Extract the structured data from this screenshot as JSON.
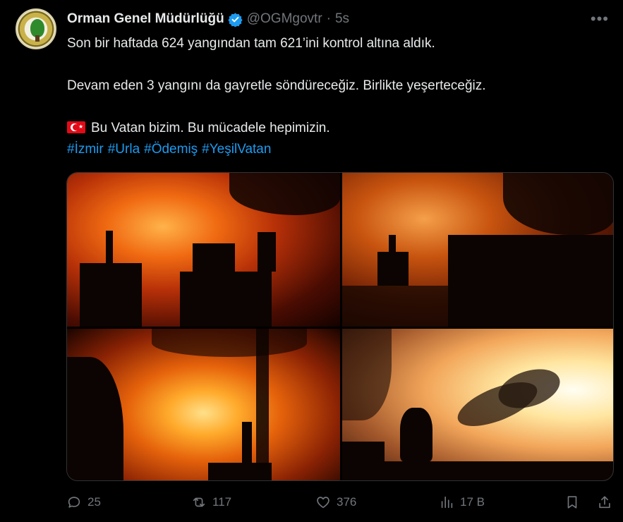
{
  "tweet": {
    "author_name": "Orman Genel Müdürlüğü",
    "handle": "@OGMgovtr",
    "separator": "·",
    "time": "5s",
    "line1": "Son bir haftada 624 yangından tam 621’ini kontrol altına aldık.",
    "line2": "Devam eden 3 yangını da gayretle söndüreceğiz. Birlikte yeşerteceğiz.",
    "line3": "Bu Vatan bizim. Bu mücadele hepimizin.",
    "hashtags": [
      "#İzmir",
      "#Urla",
      "#Ödemiş",
      "#YeşilVatan"
    ]
  },
  "actions": {
    "replies": "25",
    "reposts": "117",
    "likes": "376",
    "views": "17 B"
  },
  "icons": {
    "verified": "verified-badge-icon",
    "more": "more-icon",
    "reply": "reply-icon",
    "repost": "repost-icon",
    "like": "heart-icon",
    "views": "views-icon",
    "bookmark": "bookmark-icon",
    "share": "share-icon",
    "flag": "turkey-flag-icon"
  },
  "colors": {
    "background": "#000000",
    "text": "#e7e9ea",
    "muted": "#71767b",
    "hashtag": "#1d9bf0",
    "verified": "#1d9bf0"
  }
}
